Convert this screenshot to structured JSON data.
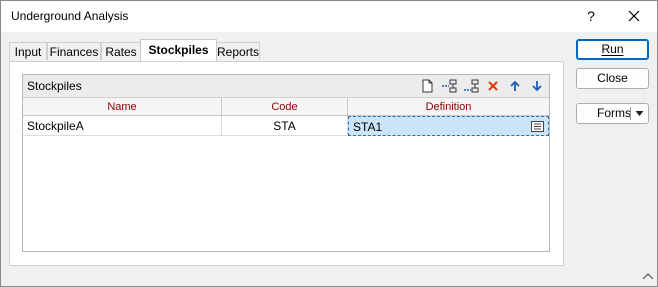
{
  "window": {
    "title": "Underground Analysis",
    "help_label": "?"
  },
  "tabs": [
    {
      "label": "Input",
      "active": false
    },
    {
      "label": "Finances",
      "active": false
    },
    {
      "label": "Rates",
      "active": false
    },
    {
      "label": "Stockpiles",
      "active": true
    },
    {
      "label": "Reports",
      "active": false
    }
  ],
  "stockpiles": {
    "title": "Stockpiles",
    "toolbar_icons": [
      "new-file-icon",
      "insert-row-icon",
      "append-row-icon",
      "delete-icon",
      "move-up-icon",
      "move-down-icon"
    ],
    "columns": [
      "Name",
      "Code",
      "Definition"
    ],
    "rows": [
      {
        "name": "StockpileA",
        "code": "STA",
        "definition": "STA1"
      }
    ]
  },
  "buttons": {
    "run": "Run",
    "close": "Close",
    "forms": "Forms"
  },
  "colors": {
    "header_text": "#8b0000",
    "selection": "#cce4f7",
    "accent": "#0067c0",
    "delete": "#d83b01",
    "arrows": "#1e5fb4"
  }
}
